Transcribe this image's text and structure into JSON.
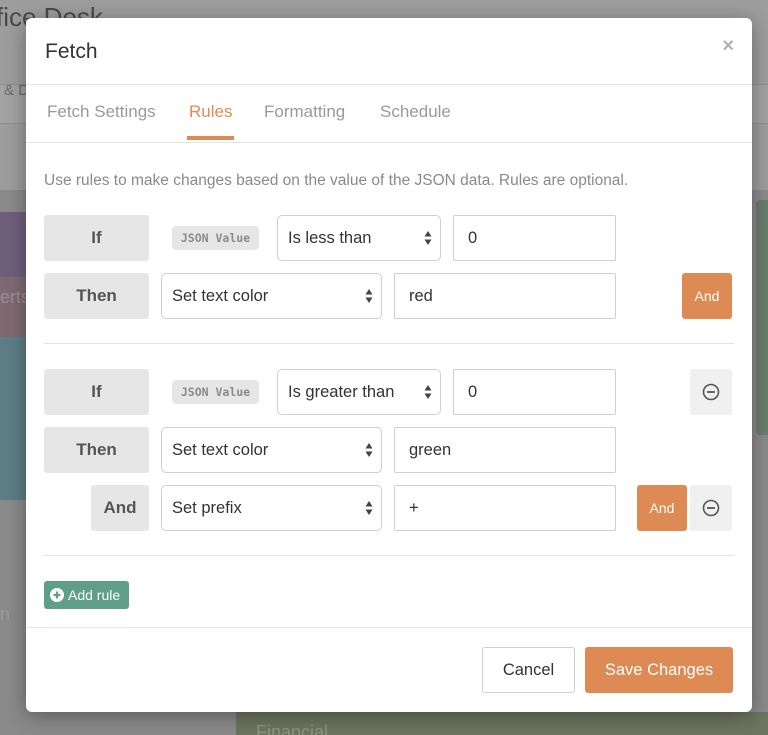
{
  "background": {
    "app_title": "fice Desk",
    "band_text": "& D",
    "tile_rose_text": "erts",
    "tile_bottom_text": "n",
    "tile_financial_text": "Financial"
  },
  "modal": {
    "title": "Fetch",
    "close_icon": "close-icon",
    "tabs": [
      {
        "label": "Fetch Settings",
        "active": false
      },
      {
        "label": "Rules",
        "active": true
      },
      {
        "label": "Formatting",
        "active": false
      },
      {
        "label": "Schedule",
        "active": false
      }
    ],
    "help_text": "Use rules to make changes based on the value of the JSON data. Rules are optional.",
    "rules": [
      {
        "if_label": "If",
        "subject": "JSON Value",
        "operator": "Is less than",
        "value": "0",
        "actions": [
          {
            "label": "Then",
            "action": "Set text color",
            "value": "red"
          }
        ],
        "and_button": "And"
      },
      {
        "if_label": "If",
        "subject": "JSON Value",
        "operator": "Is greater than",
        "value": "0",
        "actions": [
          {
            "label": "Then",
            "action": "Set text color",
            "value": "green"
          },
          {
            "label": "And",
            "action": "Set prefix",
            "value": "+"
          }
        ],
        "and_button": "And"
      }
    ],
    "add_rule_label": "Add rule",
    "footer": {
      "cancel_label": "Cancel",
      "save_label": "Save Changes"
    }
  },
  "colors": {
    "accent": "#de8a55",
    "add_rule": "#5f9e88",
    "label_bg": "#e6e6e6"
  }
}
